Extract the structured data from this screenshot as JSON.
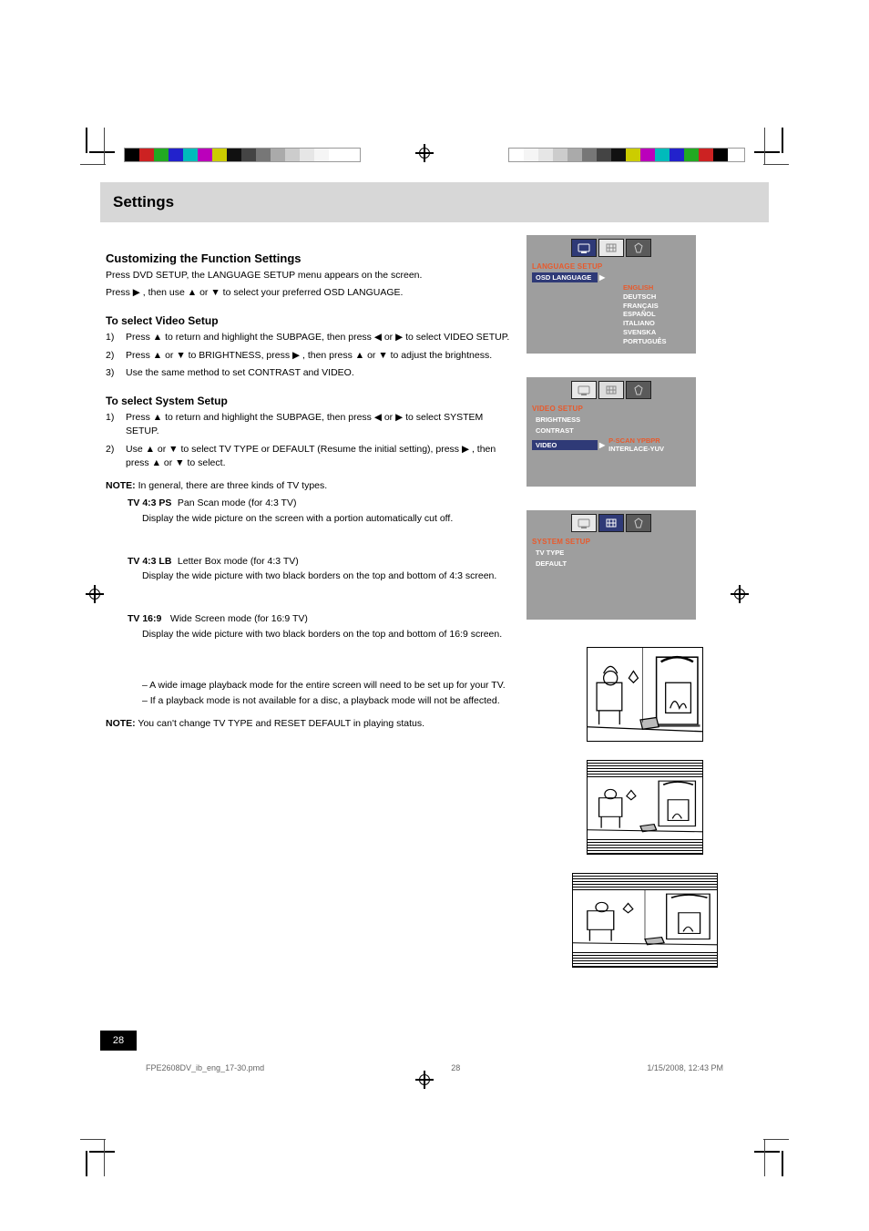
{
  "header": {
    "title": "Settings"
  },
  "intro": {
    "title": "Customizing the Function Settings",
    "p1": "Press DVD SETUP, the LANGUAGE SETUP menu appears on the screen.",
    "p2": "Press ▶ , then use ▲ or ▼ to select your preferred OSD LANGUAGE."
  },
  "video": {
    "title": "To select Video Setup",
    "s1_num": "1)",
    "s1": "Press ▲ to return and highlight the SUBPAGE, then press ◀ or ▶ to select VIDEO SETUP.",
    "s2_num": "2)",
    "s2": "Press ▲ or ▼ to BRIGHTNESS, press ▶ , then press ▲ or ▼ to adjust the brightness.",
    "s3_num": "3)",
    "s3": "Use the same method to set CONTRAST and VIDEO."
  },
  "system": {
    "title": "To select System Setup",
    "s1_num": "1)",
    "s1": "Press ▲ to return and highlight the SUBPAGE, then press ◀ or ▶ to select SYSTEM SETUP.",
    "s2_num": "2)",
    "s2": "Use ▲ or ▼ to select TV TYPE or DEFAULT (Resume the initial setting), press ▶ , then press ▲ or ▼ to select.",
    "note_label": "NOTE:",
    "note1": "In general, there are three kinds of TV types.",
    "tv1_label": "TV 4:3 PS",
    "tv1_text": "Pan Scan mode (for 4:3 TV)",
    "tv1_desc": "Display the wide picture on the screen with a portion automatically cut off.",
    "tv2_label": "TV 4:3 LB",
    "tv2_text": "Letter Box mode (for 4:3 TV)",
    "tv2_desc": "Display the wide picture with two black borders on the top and bottom of 4:3 screen.",
    "tv3_label": "TV 16:9",
    "tv3_text": "Wide Screen mode (for 16:9 TV)",
    "tv3_desc": "Display the wide picture with two black borders on the top and bottom of 16:9 screen.",
    "note2_a": "– A wide image playback mode for the entire screen will need to be set up for your TV.",
    "note2_b": "– If a playback mode is not available for a disc, a playback mode will not be affected.",
    "note3_label": "NOTE:",
    "note3": "You can't change TV TYPE and RESET DEFAULT in playing status."
  },
  "osd1": {
    "section": "LANGUAGE  SETUP",
    "row_label": "OSD  LANGUAGE",
    "options": [
      "ENGLISH",
      "DEUTSCH",
      "FRANÇAIS",
      "ESPAÑOL",
      "ITALIANO",
      "SVENSKA",
      "PORTUGUÊS"
    ]
  },
  "osd2": {
    "section": "VIDEO  SETUP",
    "row1": "BRIGHTNESS",
    "row2": "CONTRAST",
    "row3": "VIDEO",
    "opt1": "P-SCAN  YPBPR",
    "opt2": "INTERLACE-YUV"
  },
  "osd3": {
    "section": "SYSTEM  SETUP",
    "row1": "TV TYPE",
    "row2": "DEFAULT"
  },
  "page_number": "28",
  "footer": {
    "file": "FPE2608DV_ib_eng_17-30.pmd",
    "page": "28",
    "timestamp": "1/15/2008, 12:43 PM"
  }
}
